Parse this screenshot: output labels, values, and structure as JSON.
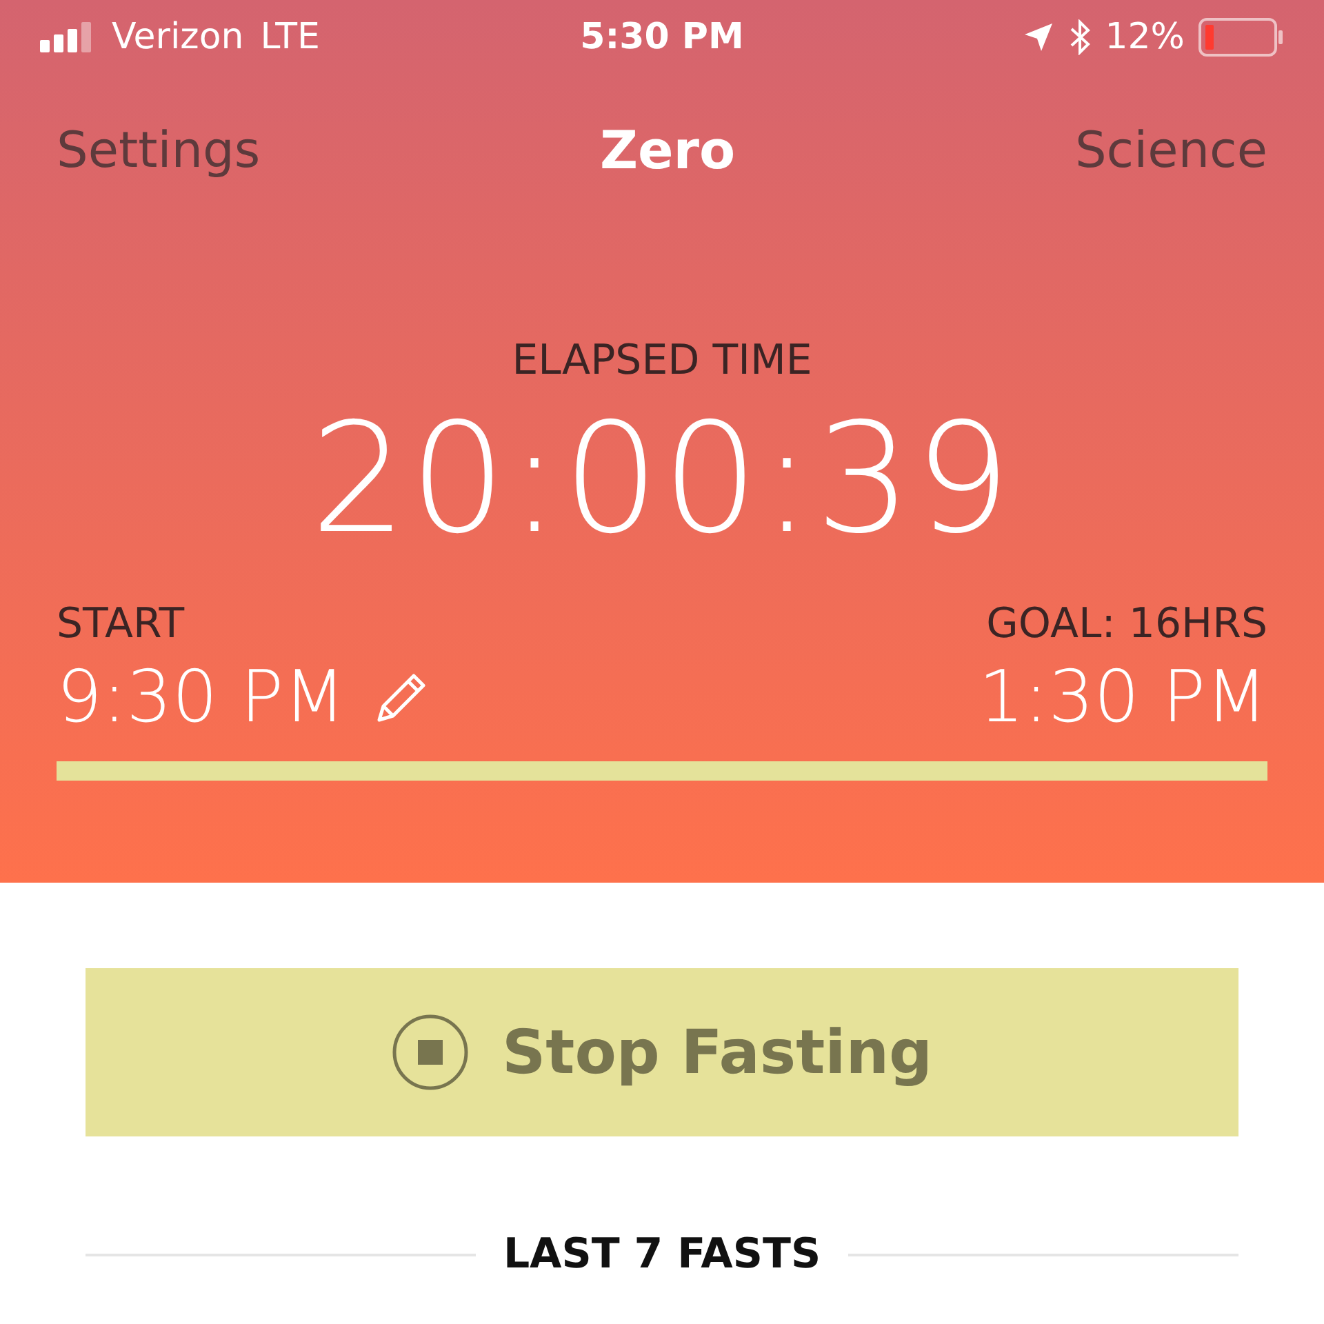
{
  "status_bar": {
    "carrier": "Verizon",
    "network": "LTE",
    "time": "5:30 PM",
    "battery": "12%"
  },
  "nav": {
    "left": "Settings",
    "title": "Zero",
    "right": "Science"
  },
  "timer": {
    "label": "ELAPSED TIME",
    "elapsed": "20:00:39"
  },
  "start": {
    "label": "START",
    "time": "9:30 PM"
  },
  "goal": {
    "label": "GOAL: 16HRS",
    "time": "1:30 PM"
  },
  "progress": {
    "level": 1
  },
  "stop_button": {
    "label": "Stop Fasting"
  },
  "section_heading": "LAST 7 FASTS"
}
